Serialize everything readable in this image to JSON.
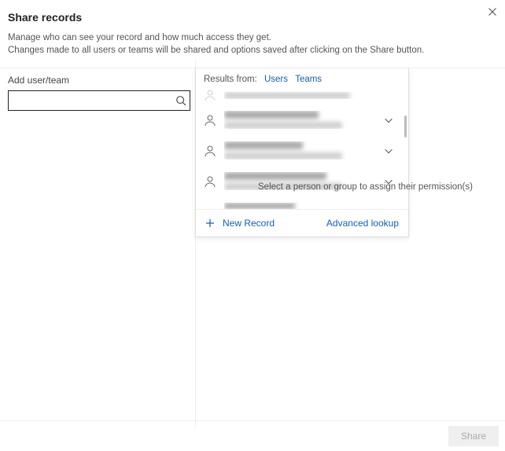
{
  "header": {
    "title": "Share records",
    "subtitle_line1": "Manage who can see your record and how much access they get.",
    "subtitle_line2": "Changes made to all users or teams will be shared and options saved after clicking on the Share button."
  },
  "left": {
    "field_label": "Add user/team",
    "search_placeholder": ""
  },
  "dropdown": {
    "results_from_label": "Results from:",
    "tab_users": "Users",
    "tab_teams": "Teams",
    "new_record": "New Record",
    "advanced_lookup": "Advanced lookup"
  },
  "helper": "Select a person or group to assign their permission(s)",
  "footer": {
    "share": "Share"
  }
}
